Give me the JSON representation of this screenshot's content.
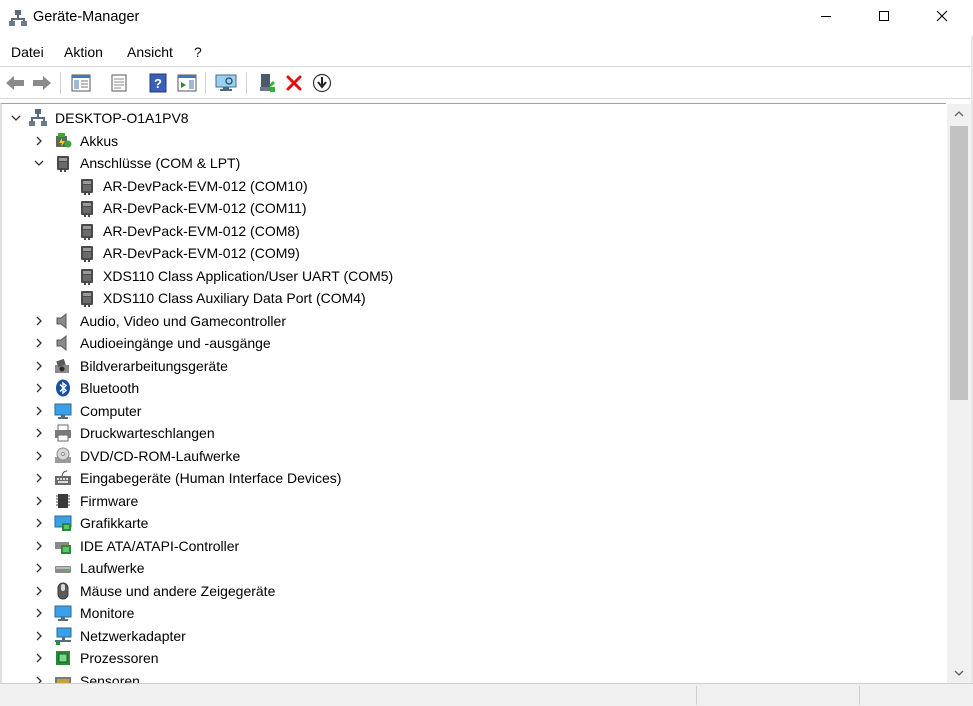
{
  "window": {
    "title": "Geräte-Manager"
  },
  "menu": [
    "Datei",
    "Aktion",
    "Ansicht",
    "?"
  ],
  "toolbar": {
    "buttons": [
      "back",
      "forward",
      "properties-pane",
      "properties",
      "help",
      "action-pane",
      "scan-hardware",
      "update-driver",
      "uninstall",
      "download-driver"
    ]
  },
  "tree": {
    "root": "DESKTOP-O1A1PV8",
    "categories": [
      {
        "label": "Akkus",
        "expanded": false,
        "icon": "battery-icon"
      },
      {
        "label": "Anschlüsse (COM & LPT)",
        "expanded": true,
        "icon": "port-icon",
        "children": [
          "AR-DevPack-EVM-012 (COM10)",
          "AR-DevPack-EVM-012 (COM11)",
          "AR-DevPack-EVM-012 (COM8)",
          "AR-DevPack-EVM-012 (COM9)",
          "XDS110 Class Application/User UART (COM5)",
          "XDS110 Class Auxiliary Data Port (COM4)"
        ]
      },
      {
        "label": "Audio, Video und Gamecontroller",
        "expanded": false,
        "icon": "speaker-icon"
      },
      {
        "label": "Audioeingänge und -ausgänge",
        "expanded": false,
        "icon": "speaker-icon"
      },
      {
        "label": "Bildverarbeitungsgeräte",
        "expanded": false,
        "icon": "camera-icon"
      },
      {
        "label": "Bluetooth",
        "expanded": false,
        "icon": "bluetooth-icon"
      },
      {
        "label": "Computer",
        "expanded": false,
        "icon": "monitor-icon"
      },
      {
        "label": "Druckwarteschlangen",
        "expanded": false,
        "icon": "printer-icon"
      },
      {
        "label": "DVD/CD-ROM-Laufwerke",
        "expanded": false,
        "icon": "disc-icon"
      },
      {
        "label": "Eingabegeräte (Human Interface Devices)",
        "expanded": false,
        "icon": "hid-icon"
      },
      {
        "label": "Firmware",
        "expanded": false,
        "icon": "chip-icon"
      },
      {
        "label": "Grafikkarte",
        "expanded": false,
        "icon": "display-adapter-icon"
      },
      {
        "label": "IDE ATA/ATAPI-Controller",
        "expanded": false,
        "icon": "ide-controller-icon"
      },
      {
        "label": "Laufwerke",
        "expanded": false,
        "icon": "drive-icon"
      },
      {
        "label": "Mäuse und andere Zeigegeräte",
        "expanded": false,
        "icon": "mouse-icon"
      },
      {
        "label": "Monitore",
        "expanded": false,
        "icon": "monitor-icon"
      },
      {
        "label": "Netzwerkadapter",
        "expanded": false,
        "icon": "network-icon"
      },
      {
        "label": "Prozessoren",
        "expanded": false,
        "icon": "processor-icon"
      },
      {
        "label": "Sensoren",
        "expanded": false,
        "icon": "sensor-icon"
      }
    ]
  },
  "colors": {
    "accent": "#1e6fd0",
    "uninstall_red": "#e01010",
    "scroll_thumb": "#c2c2c2"
  }
}
